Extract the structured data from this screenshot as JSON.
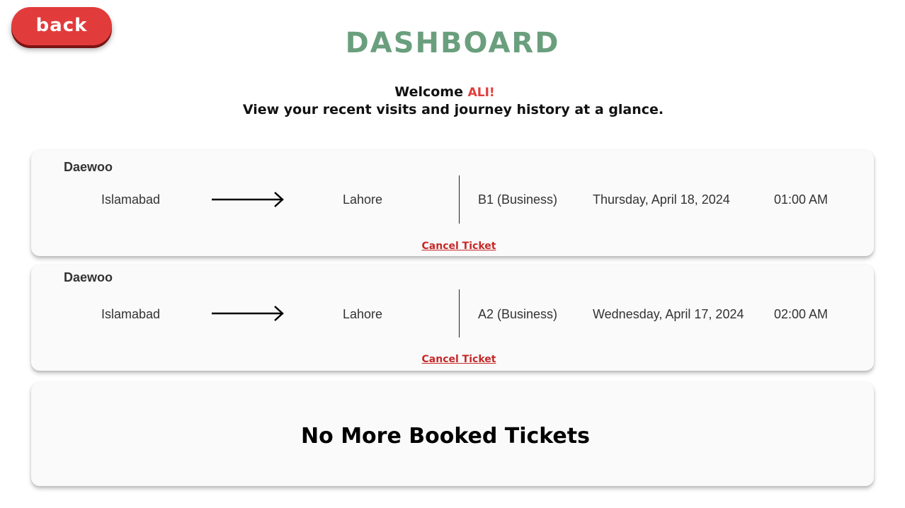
{
  "back_button": {
    "label": "back"
  },
  "header": {
    "title": "DASHBOARD"
  },
  "welcome": {
    "greeting": "Welcome",
    "name": "ALI!",
    "subtitle": "View your recent visits and journey history at a glance."
  },
  "tickets": [
    {
      "operator": "Daewoo",
      "from": "Islamabad",
      "to": "Lahore",
      "seat": "B1 (Business)",
      "date": "Thursday, April 18, 2024",
      "time": "01:00 AM",
      "cancel_label": "Cancel Ticket"
    },
    {
      "operator": "Daewoo",
      "from": "Islamabad",
      "to": "Lahore",
      "seat": "A2 (Business)",
      "date": "Wednesday, April 17, 2024",
      "time": "02:00 AM",
      "cancel_label": "Cancel Ticket"
    }
  ],
  "empty_state": {
    "message": "No More Booked Tickets"
  },
  "colors": {
    "accent": "#e23b3b",
    "title": "#6a9f7d",
    "cancel": "#c62828"
  },
  "icons": {
    "route_arrow": "arrow-right-icon"
  }
}
